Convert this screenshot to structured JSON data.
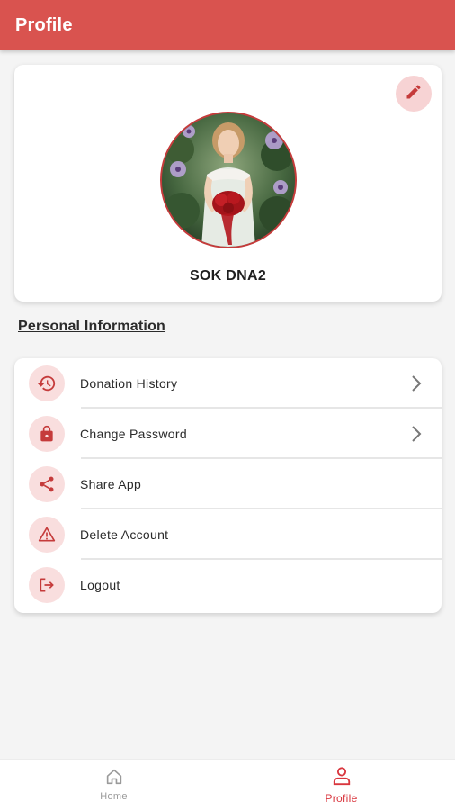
{
  "appbar": {
    "title": "Profile",
    "color": "#d9534f"
  },
  "profile": {
    "name": "SOK DNA2",
    "edit_icon": "pencil-icon",
    "avatar_icon": "profile-photo"
  },
  "section": {
    "title": "Personal Information"
  },
  "menu": {
    "items": [
      {
        "label": "Donation History",
        "icon": "history-icon",
        "chevron": true
      },
      {
        "label": "Change Password",
        "icon": "lock-icon",
        "chevron": true
      },
      {
        "label": "Share App",
        "icon": "share-icon",
        "chevron": false
      },
      {
        "label": "Delete Account",
        "icon": "warning-icon",
        "chevron": false
      },
      {
        "label": "Logout",
        "icon": "logout-icon",
        "chevron": false
      }
    ]
  },
  "bottom_nav": {
    "items": [
      {
        "label": "Home",
        "icon": "home-icon",
        "active": false
      },
      {
        "label": "Profile",
        "icon": "person-icon",
        "active": true
      }
    ],
    "active_color": "#d9363e",
    "inactive_color": "#9a9a9a"
  }
}
